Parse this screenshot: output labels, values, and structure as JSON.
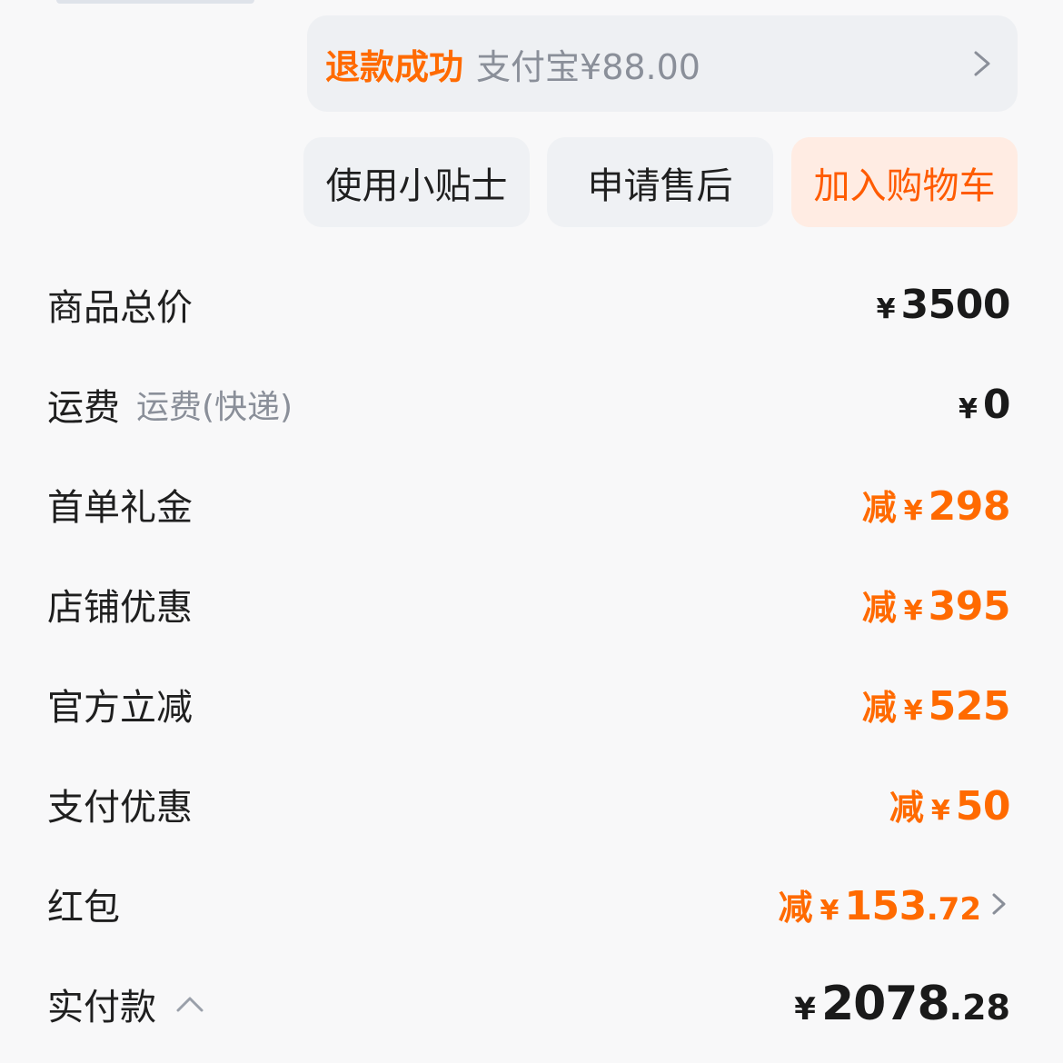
{
  "refund": {
    "status": "退款成功",
    "detail": "支付宝¥88.00",
    "chevron_icon": "chevron-right-icon"
  },
  "actions": {
    "tips_label": "使用小贴士",
    "after_sale_label": "申请售后",
    "add_cart_label": "加入购物车"
  },
  "colors": {
    "accent": "#ff6a00",
    "accent_bg": "#ffece3",
    "button_bg": "#eff1f4",
    "text_primary": "#1f1f1f",
    "text_secondary": "#8a8f99",
    "background": "#f8f8f9"
  },
  "breakdown": {
    "currency": "¥",
    "minus_label": "减",
    "total": {
      "label": "商品总价",
      "value": "3500"
    },
    "shipping": {
      "label": "运费",
      "sub": "运费(快递)",
      "value": "0"
    },
    "first_order": {
      "label": "首单礼金",
      "value": "298"
    },
    "store_discount": {
      "label": "店铺优惠",
      "value": "395"
    },
    "official": {
      "label": "官方立减",
      "value": "525"
    },
    "payment_discount": {
      "label": "支付优惠",
      "value": "50"
    },
    "red_packet": {
      "label": "红包",
      "value_int": "153",
      "value_dec": ".72",
      "chevron_icon": "chevron-right-icon"
    },
    "paid": {
      "label": "实付款",
      "value_int": "2078",
      "value_dec": ".28",
      "caret_icon": "chevron-up-icon"
    }
  }
}
